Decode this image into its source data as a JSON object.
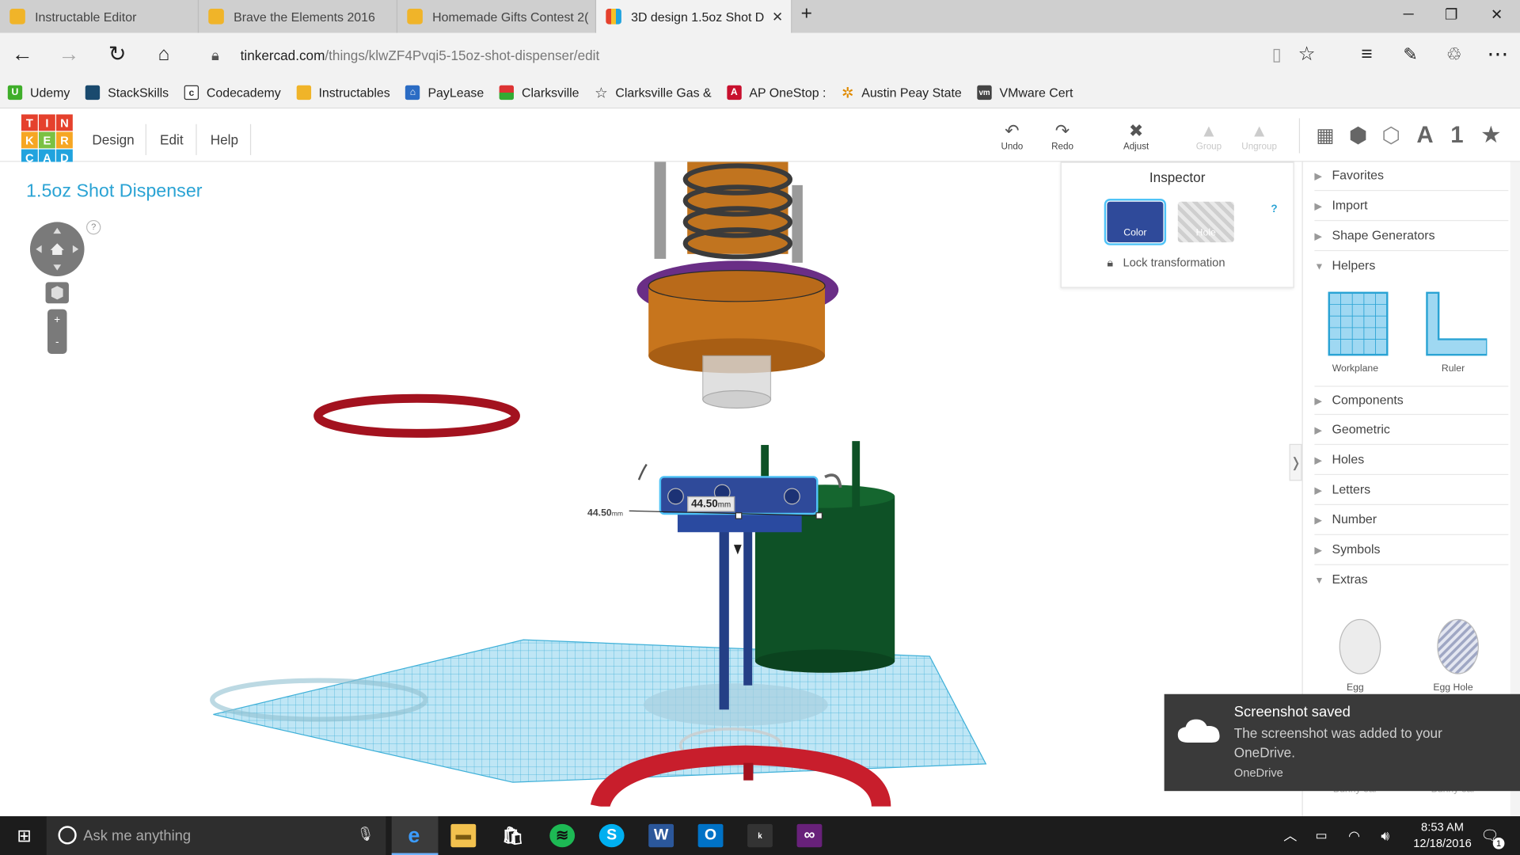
{
  "tabs": [
    {
      "title": "Instructable Editor"
    },
    {
      "title": "Brave the Elements 2016"
    },
    {
      "title": "Homemade Gifts Contest 2("
    },
    {
      "title": "3D design 1.5oz Shot D"
    }
  ],
  "address": {
    "host": "tinkercad.com",
    "path": "/things/klwZF4Pvqi5-15oz-shot-dispenser/edit"
  },
  "favorites": [
    "Udemy",
    "StackSkills",
    "Codecademy",
    "Instructables",
    "PayLease",
    "Clarksville",
    "Clarksville Gas &",
    "AP OneStop :",
    "Austin Peay State",
    "VMware Cert"
  ],
  "logo_letters": [
    "T",
    "I",
    "N",
    "K",
    "E",
    "R",
    "C",
    "A",
    "D"
  ],
  "menu": {
    "design": "Design",
    "edit": "Edit",
    "help": "Help"
  },
  "toolbar": {
    "undo": "Undo",
    "redo": "Redo",
    "adjust": "Adjust",
    "group": "Group",
    "ungroup": "Ungroup"
  },
  "view_icons": {
    "letter": "A",
    "number": "1"
  },
  "project_title": "1.5oz Shot Dispenser",
  "nav_help": "?",
  "zoom": {
    "in": "+",
    "out": "-"
  },
  "dimensions": {
    "width_label": "44.50",
    "depth_label": "44.50",
    "unit": "mm"
  },
  "inspector": {
    "title": "Inspector",
    "color_label": "Color",
    "hole_label": "Hole",
    "help": "?",
    "lock_label": "Lock transformation",
    "color_value": "#2f4a9a"
  },
  "panel": {
    "categories_top": [
      "Favorites",
      "Import",
      "Shape Generators",
      "Helpers"
    ],
    "helpers": [
      {
        "label": "Workplane"
      },
      {
        "label": "Ruler"
      }
    ],
    "categories_mid": [
      "Components",
      "Geometric",
      "Holes",
      "Letters",
      "Number",
      "Symbols",
      "Extras"
    ],
    "extras": [
      {
        "label": "Egg"
      },
      {
        "label": "Egg Hole"
      }
    ],
    "hidden_partial": [
      "Bunny ear",
      "Bunny ear"
    ]
  },
  "toast": {
    "title": "Screenshot saved",
    "body": "The screenshot was added to your OneDrive.",
    "source": "OneDrive"
  },
  "taskbar": {
    "search_placeholder": "Ask me anything",
    "time": "8:53 AM",
    "date": "12/18/2016",
    "notif_count": "1"
  }
}
